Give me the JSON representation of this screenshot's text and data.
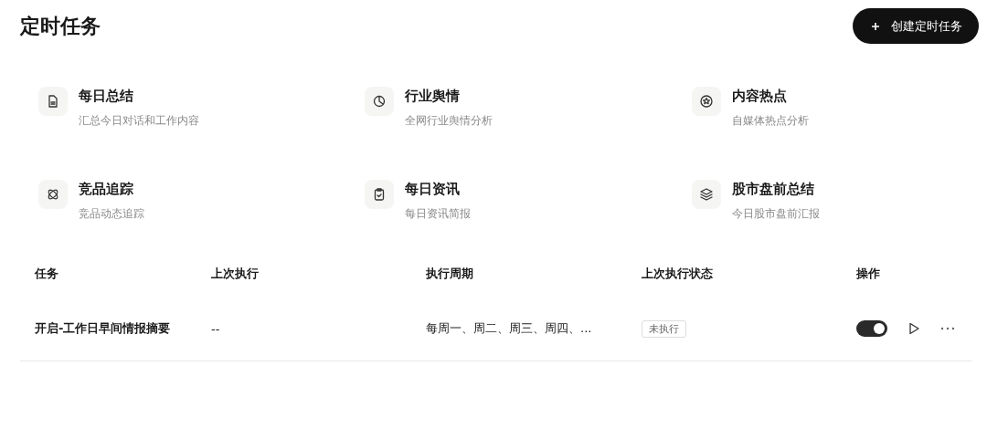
{
  "page": {
    "title": "定时任务"
  },
  "create_button": {
    "label": "创建定时任务"
  },
  "templates": [
    {
      "title": "每日总结",
      "description": "汇总今日对话和工作内容"
    },
    {
      "title": "行业舆情",
      "description": "全网行业舆情分析"
    },
    {
      "title": "内容热点",
      "description": "自媒体热点分析"
    },
    {
      "title": "竞品追踪",
      "description": "竞品动态追踪"
    },
    {
      "title": "每日资讯",
      "description": "每日资讯简报"
    },
    {
      "title": "股市盘前总结",
      "description": "今日股市盘前汇报"
    }
  ],
  "table": {
    "columns": [
      "任务",
      "上次执行",
      "执行周期",
      "上次执行状态",
      "操作"
    ],
    "rows": [
      {
        "task": "开启-工作日早间情报摘要",
        "last_run": "--",
        "schedule": "每周一、周二、周三、周四、...",
        "status": "未执行",
        "on": true
      }
    ]
  }
}
